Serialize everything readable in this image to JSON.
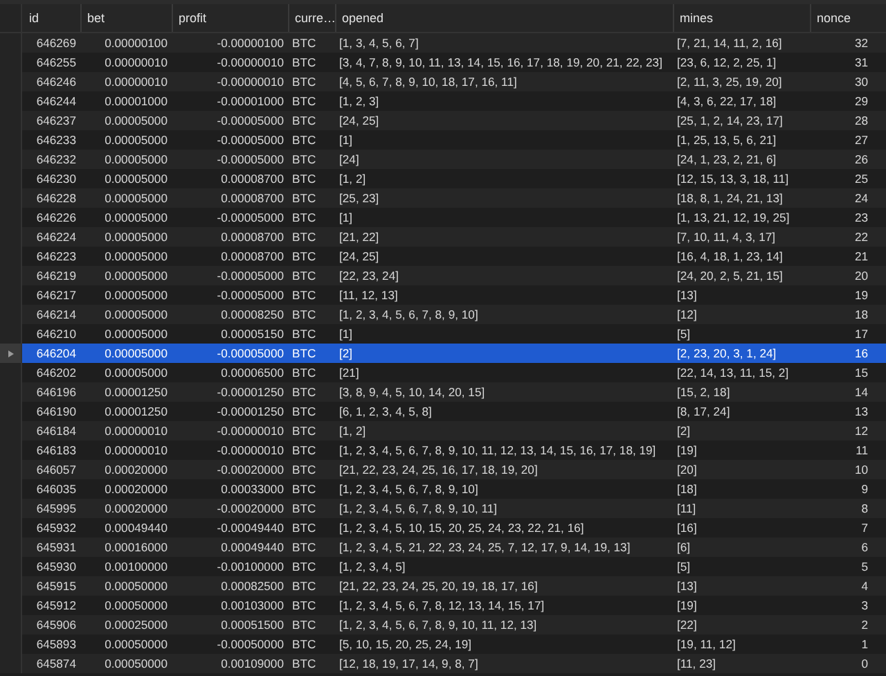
{
  "columns": [
    "id",
    "bet",
    "profit",
    "curre…",
    "opened",
    "mines",
    "nonce"
  ],
  "rows": [
    {
      "id": "646269",
      "bet": "0.00000100",
      "profit": "-0.00000100",
      "currency": "BTC",
      "opened": "[1, 3, 4, 5, 6, 7]",
      "mines": "[7, 21, 14, 11, 2, 16]",
      "nonce": "32",
      "selected": false
    },
    {
      "id": "646255",
      "bet": "0.00000010",
      "profit": "-0.00000010",
      "currency": "BTC",
      "opened": "[3, 4, 7, 8, 9, 10, 11, 13, 14, 15, 16, 17, 18, 19, 20, 21, 22, 23]",
      "mines": "[23, 6, 12, 2, 25, 1]",
      "nonce": "31",
      "selected": false
    },
    {
      "id": "646246",
      "bet": "0.00000010",
      "profit": "-0.00000010",
      "currency": "BTC",
      "opened": "[4, 5, 6, 7, 8, 9, 10, 18, 17, 16, 11]",
      "mines": "[2, 11, 3, 25, 19, 20]",
      "nonce": "30",
      "selected": false
    },
    {
      "id": "646244",
      "bet": "0.00001000",
      "profit": "-0.00001000",
      "currency": "BTC",
      "opened": "[1, 2, 3]",
      "mines": "[4, 3, 6, 22, 17, 18]",
      "nonce": "29",
      "selected": false
    },
    {
      "id": "646237",
      "bet": "0.00005000",
      "profit": "-0.00005000",
      "currency": "BTC",
      "opened": "[24, 25]",
      "mines": "[25, 1, 2, 14, 23, 17]",
      "nonce": "28",
      "selected": false
    },
    {
      "id": "646233",
      "bet": "0.00005000",
      "profit": "-0.00005000",
      "currency": "BTC",
      "opened": "[1]",
      "mines": "[1, 25, 13, 5, 6, 21]",
      "nonce": "27",
      "selected": false
    },
    {
      "id": "646232",
      "bet": "0.00005000",
      "profit": "-0.00005000",
      "currency": "BTC",
      "opened": "[24]",
      "mines": "[24, 1, 23, 2, 21, 6]",
      "nonce": "26",
      "selected": false
    },
    {
      "id": "646230",
      "bet": "0.00005000",
      "profit": "0.00008700",
      "currency": "BTC",
      "opened": "[1, 2]",
      "mines": "[12, 15, 13, 3, 18, 11]",
      "nonce": "25",
      "selected": false
    },
    {
      "id": "646228",
      "bet": "0.00005000",
      "profit": "0.00008700",
      "currency": "BTC",
      "opened": "[25, 23]",
      "mines": "[18, 8, 1, 24, 21, 13]",
      "nonce": "24",
      "selected": false
    },
    {
      "id": "646226",
      "bet": "0.00005000",
      "profit": "-0.00005000",
      "currency": "BTC",
      "opened": "[1]",
      "mines": "[1, 13, 21, 12, 19, 25]",
      "nonce": "23",
      "selected": false
    },
    {
      "id": "646224",
      "bet": "0.00005000",
      "profit": "0.00008700",
      "currency": "BTC",
      "opened": "[21, 22]",
      "mines": "[7, 10, 11, 4, 3, 17]",
      "nonce": "22",
      "selected": false
    },
    {
      "id": "646223",
      "bet": "0.00005000",
      "profit": "0.00008700",
      "currency": "BTC",
      "opened": "[24, 25]",
      "mines": "[16, 4, 18, 1, 23, 14]",
      "nonce": "21",
      "selected": false
    },
    {
      "id": "646219",
      "bet": "0.00005000",
      "profit": "-0.00005000",
      "currency": "BTC",
      "opened": "[22, 23, 24]",
      "mines": "[24, 20, 2, 5, 21, 15]",
      "nonce": "20",
      "selected": false
    },
    {
      "id": "646217",
      "bet": "0.00005000",
      "profit": "-0.00005000",
      "currency": "BTC",
      "opened": "[11, 12, 13]",
      "mines": "[13]",
      "nonce": "19",
      "selected": false
    },
    {
      "id": "646214",
      "bet": "0.00005000",
      "profit": "0.00008250",
      "currency": "BTC",
      "opened": "[1, 2, 3, 4, 5, 6, 7, 8, 9, 10]",
      "mines": "[12]",
      "nonce": "18",
      "selected": false
    },
    {
      "id": "646210",
      "bet": "0.00005000",
      "profit": "0.00005150",
      "currency": "BTC",
      "opened": "[1]",
      "mines": "[5]",
      "nonce": "17",
      "selected": false
    },
    {
      "id": "646204",
      "bet": "0.00005000",
      "profit": "-0.00005000",
      "currency": "BTC",
      "opened": "[2]",
      "mines": "[2, 23, 20, 3, 1, 24]",
      "nonce": "16",
      "selected": true
    },
    {
      "id": "646202",
      "bet": "0.00005000",
      "profit": "0.00006500",
      "currency": "BTC",
      "opened": "[21]",
      "mines": "[22, 14, 13, 11, 15, 2]",
      "nonce": "15",
      "selected": false
    },
    {
      "id": "646196",
      "bet": "0.00001250",
      "profit": "-0.00001250",
      "currency": "BTC",
      "opened": "[3, 8, 9, 4, 5, 10, 14, 20, 15]",
      "mines": "[15, 2, 18]",
      "nonce": "14",
      "selected": false
    },
    {
      "id": "646190",
      "bet": "0.00001250",
      "profit": "-0.00001250",
      "currency": "BTC",
      "opened": "[6, 1, 2, 3, 4, 5, 8]",
      "mines": "[8, 17, 24]",
      "nonce": "13",
      "selected": false
    },
    {
      "id": "646184",
      "bet": "0.00000010",
      "profit": "-0.00000010",
      "currency": "BTC",
      "opened": "[1, 2]",
      "mines": "[2]",
      "nonce": "12",
      "selected": false
    },
    {
      "id": "646183",
      "bet": "0.00000010",
      "profit": "-0.00000010",
      "currency": "BTC",
      "opened": "[1, 2, 3, 4, 5, 6, 7, 8, 9, 10, 11, 12, 13, 14, 15, 16, 17, 18, 19]",
      "mines": "[19]",
      "nonce": "11",
      "selected": false
    },
    {
      "id": "646057",
      "bet": "0.00020000",
      "profit": "-0.00020000",
      "currency": "BTC",
      "opened": "[21, 22, 23, 24, 25, 16, 17, 18, 19, 20]",
      "mines": "[20]",
      "nonce": "10",
      "selected": false
    },
    {
      "id": "646035",
      "bet": "0.00020000",
      "profit": "0.00033000",
      "currency": "BTC",
      "opened": "[1, 2, 3, 4, 5, 6, 7, 8, 9, 10]",
      "mines": "[18]",
      "nonce": "9",
      "selected": false
    },
    {
      "id": "645995",
      "bet": "0.00020000",
      "profit": "-0.00020000",
      "currency": "BTC",
      "opened": "[1, 2, 3, 4, 5, 6, 7, 8, 9, 10, 11]",
      "mines": "[11]",
      "nonce": "8",
      "selected": false
    },
    {
      "id": "645932",
      "bet": "0.00049440",
      "profit": "-0.00049440",
      "currency": "BTC",
      "opened": "[1, 2, 3, 4, 5, 10, 15, 20, 25, 24, 23, 22, 21, 16]",
      "mines": "[16]",
      "nonce": "7",
      "selected": false
    },
    {
      "id": "645931",
      "bet": "0.00016000",
      "profit": "0.00049440",
      "currency": "BTC",
      "opened": "[1, 2, 3, 4, 5, 21, 22, 23, 24, 25, 7, 12, 17, 9, 14, 19, 13]",
      "mines": "[6]",
      "nonce": "6",
      "selected": false
    },
    {
      "id": "645930",
      "bet": "0.00100000",
      "profit": "-0.00100000",
      "currency": "BTC",
      "opened": "[1, 2, 3, 4, 5]",
      "mines": "[5]",
      "nonce": "5",
      "selected": false
    },
    {
      "id": "645915",
      "bet": "0.00050000",
      "profit": "0.00082500",
      "currency": "BTC",
      "opened": "[21, 22, 23, 24, 25, 20, 19, 18, 17, 16]",
      "mines": "[13]",
      "nonce": "4",
      "selected": false
    },
    {
      "id": "645912",
      "bet": "0.00050000",
      "profit": "0.00103000",
      "currency": "BTC",
      "opened": "[1, 2, 3, 4, 5, 6, 7, 8, 12, 13, 14, 15, 17]",
      "mines": "[19]",
      "nonce": "3",
      "selected": false
    },
    {
      "id": "645906",
      "bet": "0.00025000",
      "profit": "0.00051500",
      "currency": "BTC",
      "opened": "[1, 2, 3, 4, 5, 6, 7, 8, 9, 10, 11, 12, 13]",
      "mines": "[22]",
      "nonce": "2",
      "selected": false
    },
    {
      "id": "645893",
      "bet": "0.00050000",
      "profit": "-0.00050000",
      "currency": "BTC",
      "opened": "[5, 10, 15, 20, 25, 24, 19]",
      "mines": "[19, 11, 12]",
      "nonce": "1",
      "selected": false
    },
    {
      "id": "645874",
      "bet": "0.00050000",
      "profit": "0.00109000",
      "currency": "BTC",
      "opened": "[12, 18, 19, 17, 14, 9, 8, 7]",
      "mines": "[11, 23]",
      "nonce": "0",
      "selected": false
    }
  ]
}
